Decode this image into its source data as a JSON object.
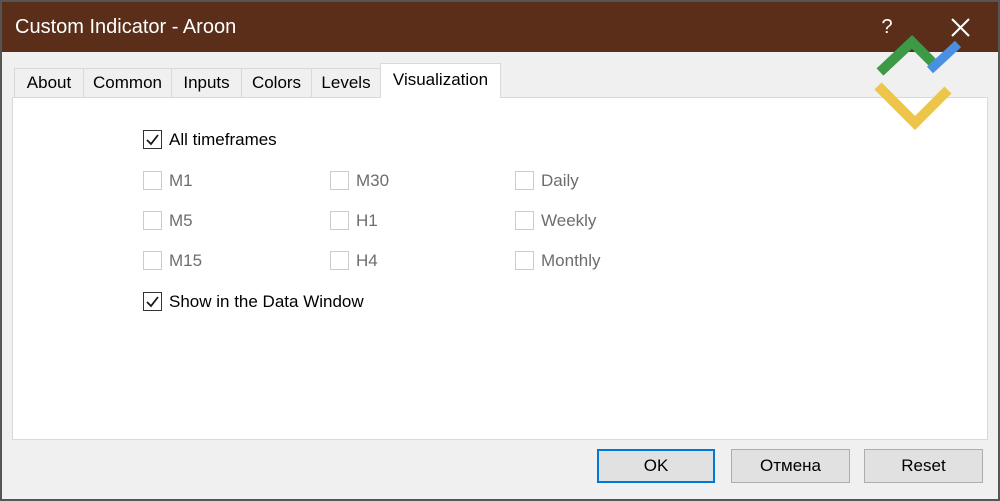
{
  "window": {
    "title": "Custom Indicator - Aroon",
    "help_label": "?",
    "close_icon": "close-icon"
  },
  "theme": {
    "titlebar": "#5b2e19",
    "focus_accent": "#0078d7",
    "dialog_bg": "#f0f0f0",
    "panel_bg": "#ffffff",
    "disabled_text": "#6d6d6d"
  },
  "logo": {
    "icon": "brand-logo-icon",
    "colors": {
      "green": "#3c9a47",
      "blue": "#4a90e2",
      "yellow": "#edc54a"
    }
  },
  "tabs": [
    {
      "label": "About",
      "active": false
    },
    {
      "label": "Common",
      "active": false
    },
    {
      "label": "Inputs",
      "active": false
    },
    {
      "label": "Colors",
      "active": false
    },
    {
      "label": "Levels",
      "active": false
    },
    {
      "label": "Visualization",
      "active": true
    }
  ],
  "visualization": {
    "all_timeframes": {
      "label": "All timeframes",
      "checked": true,
      "enabled": true
    },
    "timeframes": [
      {
        "label": "M1",
        "checked": false,
        "enabled": false
      },
      {
        "label": "M5",
        "checked": false,
        "enabled": false
      },
      {
        "label": "M15",
        "checked": false,
        "enabled": false
      },
      {
        "label": "M30",
        "checked": false,
        "enabled": false
      },
      {
        "label": "H1",
        "checked": false,
        "enabled": false
      },
      {
        "label": "H4",
        "checked": false,
        "enabled": false
      },
      {
        "label": "Daily",
        "checked": false,
        "enabled": false
      },
      {
        "label": "Weekly",
        "checked": false,
        "enabled": false
      },
      {
        "label": "Monthly",
        "checked": false,
        "enabled": false
      }
    ],
    "show_in_data_window": {
      "label": "Show in the Data Window",
      "checked": true,
      "enabled": true
    }
  },
  "buttons": {
    "ok": {
      "label": "OK",
      "focused": true
    },
    "cancel": {
      "label": "Отмена",
      "focused": false
    },
    "reset": {
      "label": "Reset",
      "focused": false
    }
  }
}
